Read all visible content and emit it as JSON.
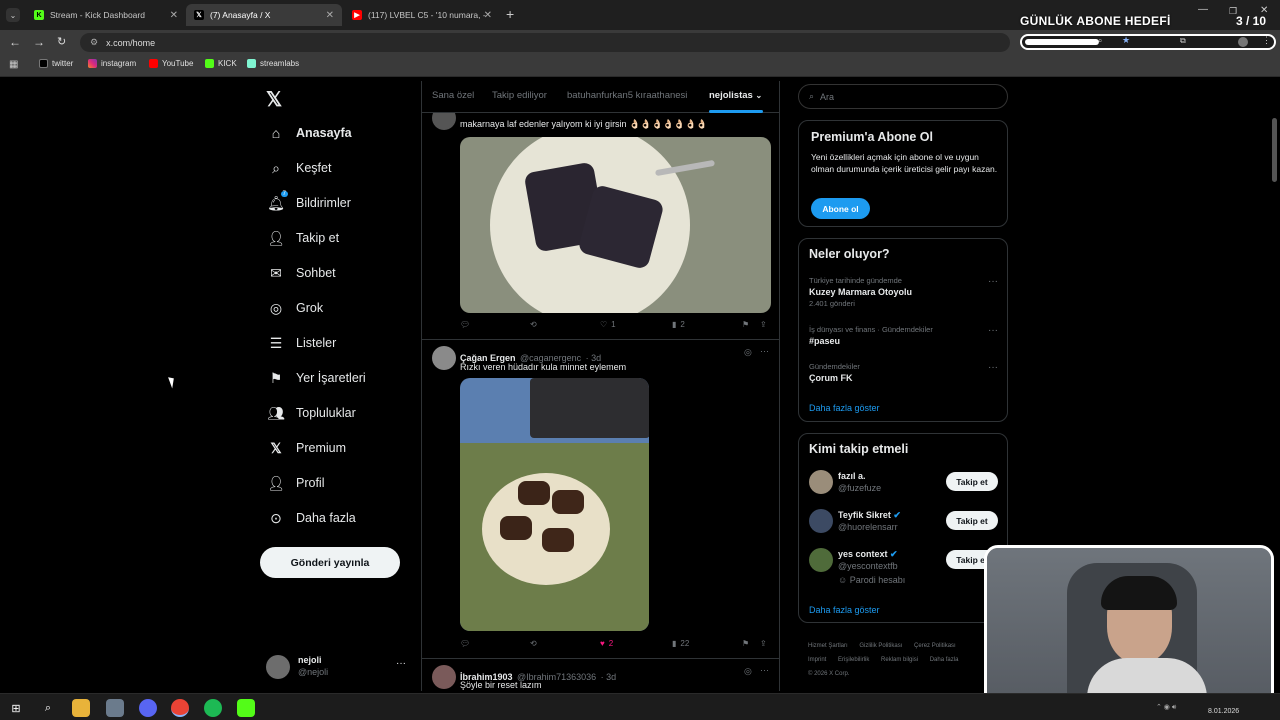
{
  "browser": {
    "tabs": [
      {
        "title": "Stream - Kick Dashboard"
      },
      {
        "title": "(7) Anasayfa / X"
      },
      {
        "title": "(117) LVBEL C5 - '10 numara, -"
      }
    ],
    "url": "x.com/home",
    "bookmarks": [
      {
        "label": "twitter"
      },
      {
        "label": "instagram"
      },
      {
        "label": "YouTube"
      },
      {
        "label": "KICK"
      },
      {
        "label": "streamlabs"
      }
    ]
  },
  "overlay": {
    "goal_title": "GÜNLÜK ABONE HEDEFİ",
    "goal_count": "3 / 10",
    "goal_progress": 0.3
  },
  "sidebar": {
    "logo": "x-logo-icon",
    "items": [
      {
        "label": "Anasayfa",
        "icon": "home-icon"
      },
      {
        "label": "Keşfet",
        "icon": "search-icon"
      },
      {
        "label": "Bildirimler",
        "icon": "bell-icon",
        "badge": "7"
      },
      {
        "label": "Takip et",
        "icon": "add-user-icon"
      },
      {
        "label": "Sohbet",
        "icon": "mail-icon"
      },
      {
        "label": "Grok",
        "icon": "grok-icon"
      },
      {
        "label": "Listeler",
        "icon": "list-icon"
      },
      {
        "label": "Yer İşaretleri",
        "icon": "bookmark-icon"
      },
      {
        "label": "Topluluklar",
        "icon": "communities-icon"
      },
      {
        "label": "Premium",
        "icon": "x-icon"
      },
      {
        "label": "Profil",
        "icon": "profile-icon"
      },
      {
        "label": "Daha fazla",
        "icon": "more-circle-icon"
      }
    ],
    "post_button": "Gönderi yayınla",
    "account": {
      "name": "nejoli",
      "handle": "@nejoli"
    }
  },
  "feed": {
    "tabs": [
      "Sana özel",
      "Takip ediliyor",
      "batuhanfurkan5 kıraathanesi",
      "nejolistas"
    ],
    "tweets": [
      {
        "text": "makarnaya laf edenler yalıyom ki iyi girsin 👌🏻👌🏻👌🏻👌🏻👌🏻👌🏻👌🏻",
        "likes": "1",
        "views": "2"
      },
      {
        "name": "Çağan Ergen",
        "handle": "@caganergenc",
        "time": "· 3d",
        "text": "Rızkı veren hüdadır kula minnet eylemem",
        "likes": "2",
        "views": "22"
      },
      {
        "name": "İbrahim1903",
        "handle": "@Ibrahim71363036",
        "time": "· 3d",
        "text": "Şöyle bir reset lazım"
      }
    ]
  },
  "right": {
    "search_placeholder": "Ara",
    "premium": {
      "title": "Premium'a Abone Ol",
      "desc": "Yeni özellikleri açmak için abone ol ve uygun olman durumunda içerik üreticisi gelir payı kazan.",
      "button": "Abone ol"
    },
    "trends": {
      "title": "Neler oluyor?",
      "items": [
        {
          "context": "Türkiye tarihinde gündemde",
          "name": "Kuzey Marmara Otoyolu",
          "count": "2.401 gönderi"
        },
        {
          "context": "İş dünyası ve finans · Gündemdekiler",
          "name": "#paseu",
          "count": ""
        },
        {
          "context": "Gündemdekiler",
          "name": "Çorum FK",
          "count": ""
        }
      ],
      "more": "Daha fazla göster"
    },
    "who_to_follow": {
      "title": "Kimi takip etmeli",
      "users": [
        {
          "name": "fazıl a.",
          "handle": "@fuzefuze",
          "button": "Takip et"
        },
        {
          "name": "Teyfik Sikret",
          "handle": "@huorelensarr",
          "button": "Takip et"
        },
        {
          "name": "yes context",
          "handle": "@yescontextfb",
          "note": "Parodi hesabı",
          "button": "Takip et"
        }
      ],
      "more": "Daha fazla göster"
    },
    "footer": {
      "links": [
        "Hizmet Şartları",
        "Gizlilik Politikası",
        "Çerez Politikası",
        "Imprint",
        "Erişilebilirlik",
        "Reklam bilgisi",
        "Daha fazla"
      ],
      "copyright": "© 2026 X Corp."
    }
  },
  "taskbar": {
    "date": "8.01.2026"
  }
}
